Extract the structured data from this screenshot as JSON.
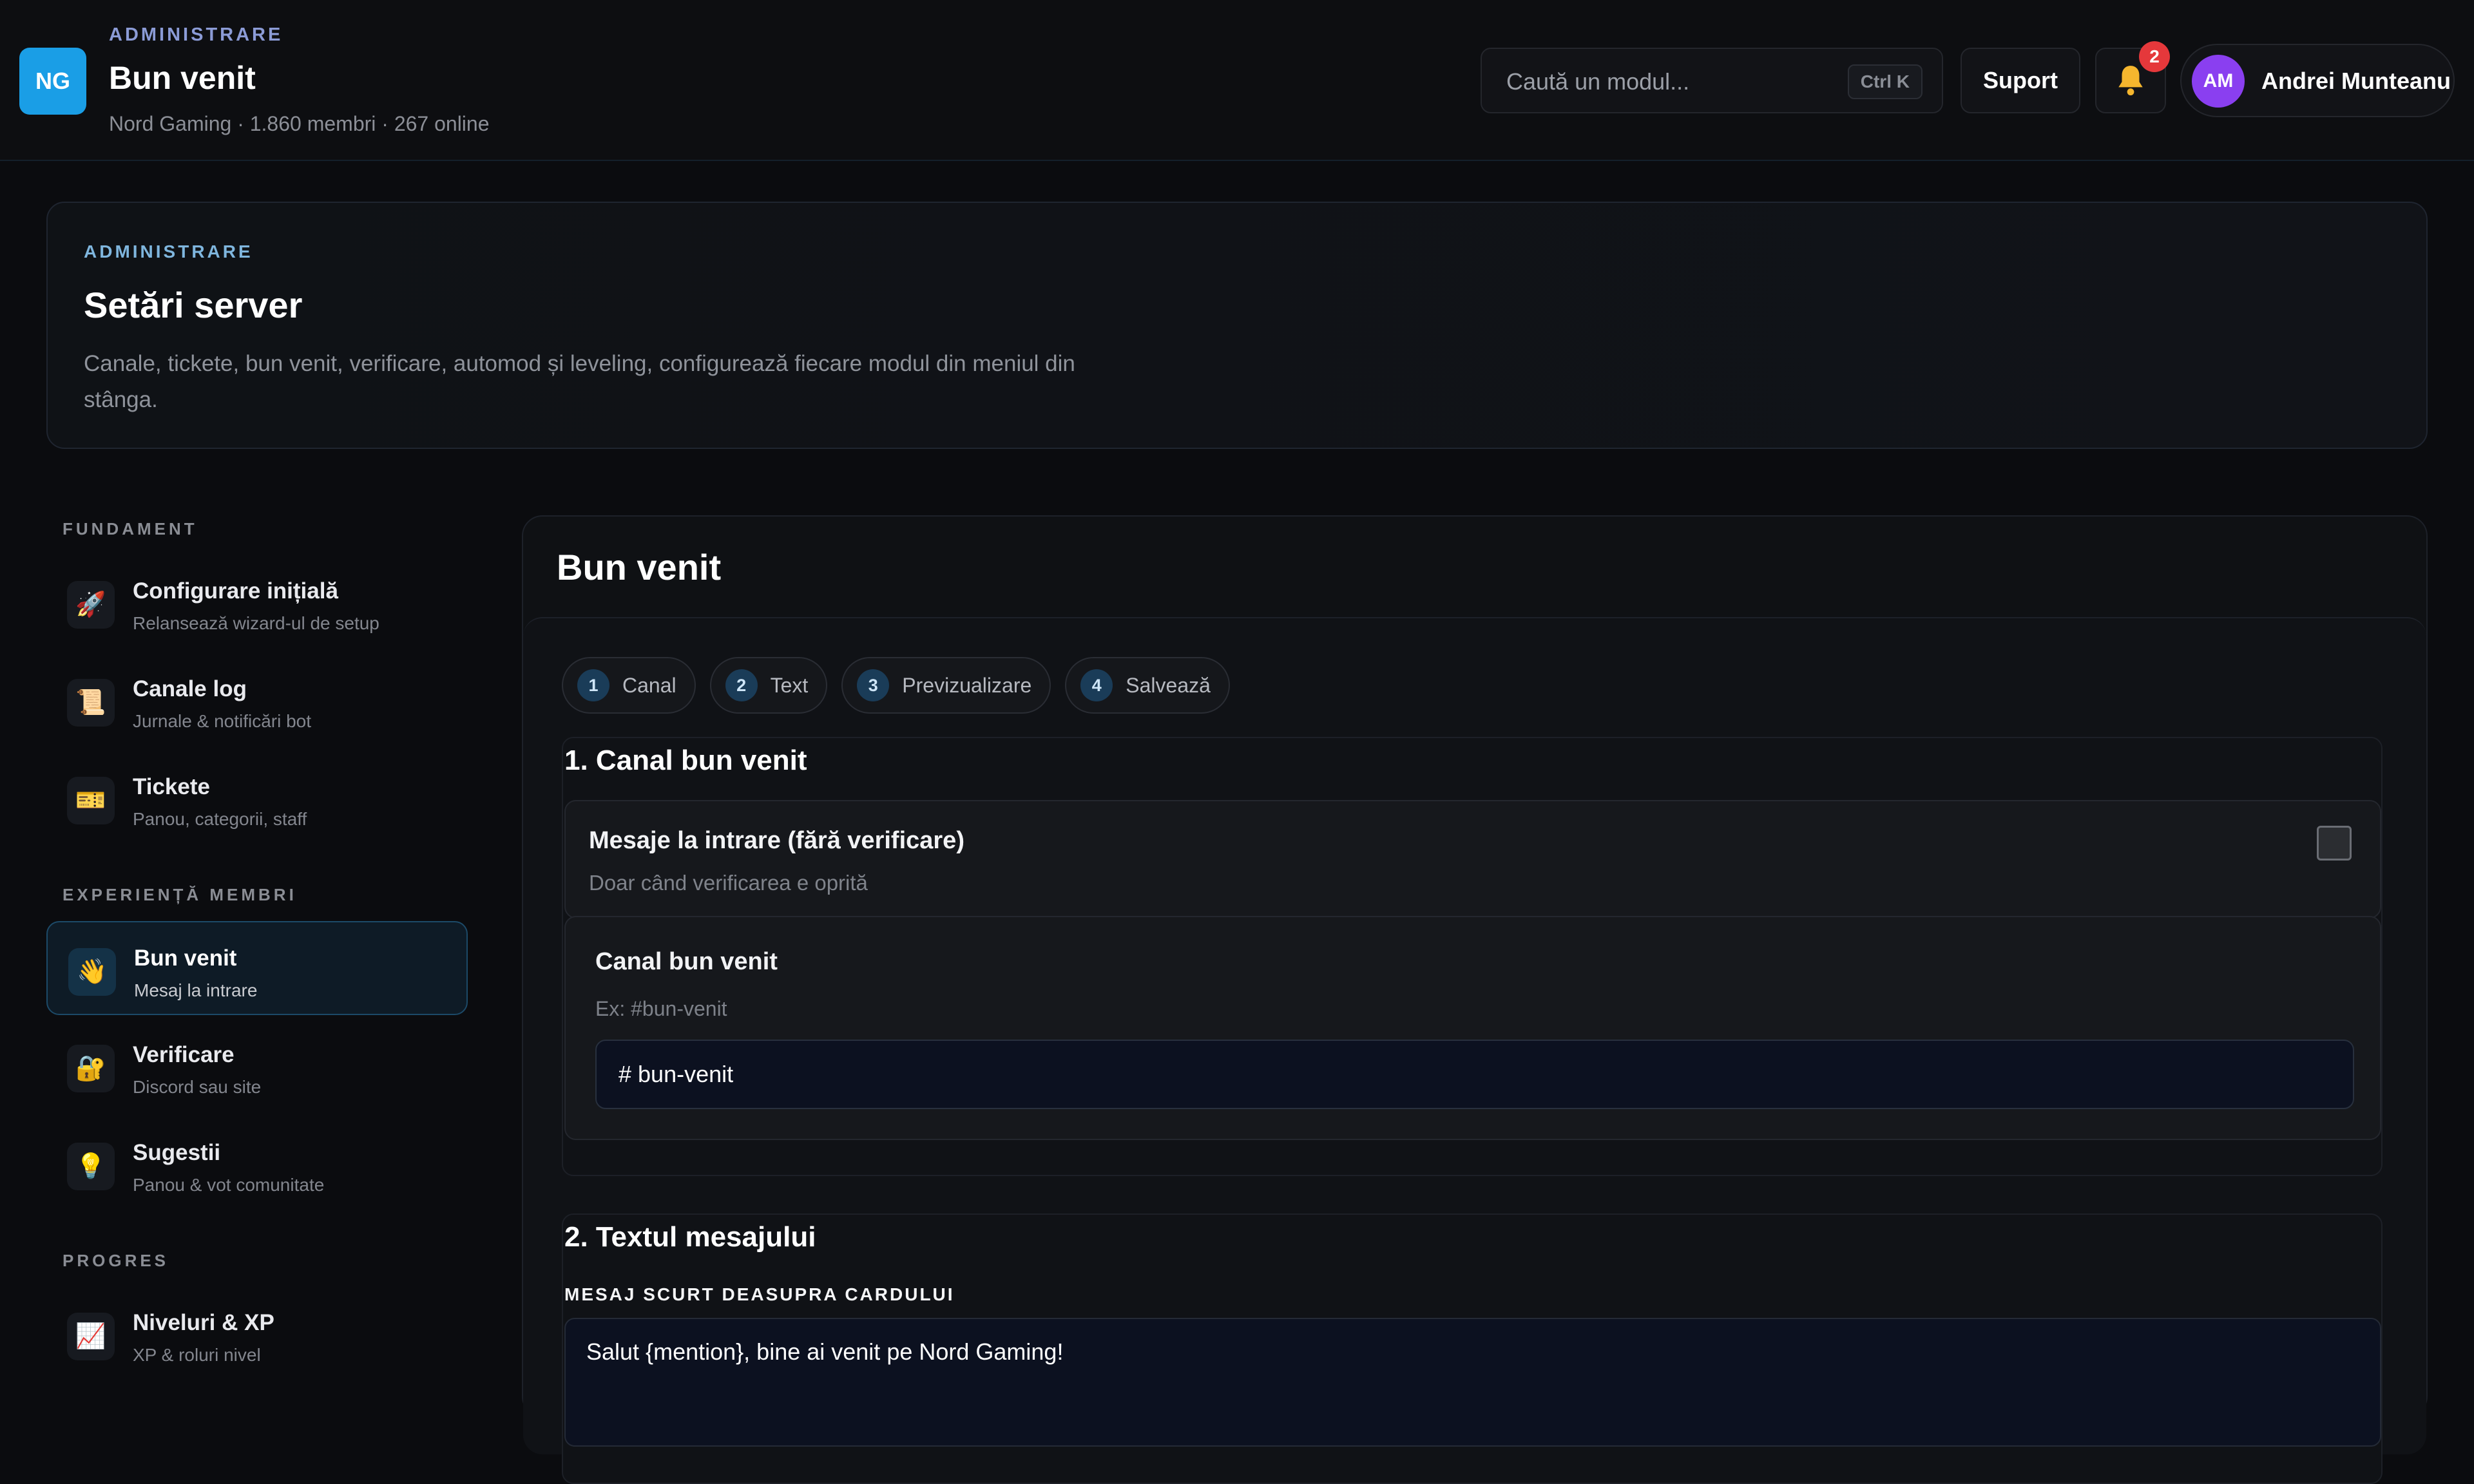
{
  "header": {
    "logo_initials": "NG",
    "eyebrow": "ADMINISTRARE",
    "title": "Bun venit",
    "subtitle": "Nord Gaming · 1.860 membri · 267 online",
    "search_placeholder": "Caută un modul...",
    "search_shortcut": "Ctrl K",
    "support_label": "Suport",
    "notification_count": "2",
    "user_initials": "AM",
    "user_name": "Andrei Munteanu"
  },
  "hero": {
    "eyebrow": "ADMINISTRARE",
    "title": "Setări server",
    "description": "Canale, tickete, bun venit, verificare, automod și leveling, configurează fiecare modul din meniul din stânga."
  },
  "sidebar": {
    "sections": [
      {
        "title": "FUNDAMENT",
        "items": [
          {
            "icon": "rocket-icon",
            "glyph": "🚀",
            "label": "Configurare inițială",
            "sub": "Relansează wizard-ul de setup"
          },
          {
            "icon": "scroll-icon",
            "glyph": "📜",
            "label": "Canale log",
            "sub": "Jurnale & notificări bot"
          },
          {
            "icon": "ticket-icon",
            "glyph": "🎫",
            "label": "Tickete",
            "sub": "Panou, categorii, staff"
          }
        ]
      },
      {
        "title": "EXPERIENȚĂ MEMBRI",
        "items": [
          {
            "icon": "wave-icon",
            "glyph": "👋",
            "label": "Bun venit",
            "sub": "Mesaj la intrare",
            "active": true
          },
          {
            "icon": "lock-icon",
            "glyph": "🔐",
            "label": "Verificare",
            "sub": "Discord sau site"
          },
          {
            "icon": "lightbulb-icon",
            "glyph": "💡",
            "label": "Sugestii",
            "sub": "Panou & vot comunitate"
          }
        ]
      },
      {
        "title": "PROGRES",
        "items": [
          {
            "icon": "chart-icon",
            "glyph": "📈",
            "label": "Niveluri & XP",
            "sub": "XP & roluri nivel"
          }
        ]
      }
    ]
  },
  "main": {
    "title": "Bun venit",
    "steps": [
      {
        "num": "1",
        "label": "Canal"
      },
      {
        "num": "2",
        "label": "Text"
      },
      {
        "num": "3",
        "label": "Previzualizare"
      },
      {
        "num": "4",
        "label": "Salvează"
      }
    ],
    "section1": {
      "title": "1. Canal bun venit",
      "toggle_title": "Mesaje la intrare (fără verificare)",
      "toggle_sub": "Doar când verificarea e oprită",
      "toggle_checked": false,
      "field_label": "Canal bun venit",
      "field_hint": "Ex: #bun-venit",
      "field_value": "# bun-venit"
    },
    "section2": {
      "title": "2. Textul mesajului",
      "short_label": "MESAJ SCURT DEASUPRA CARDULUI",
      "short_value": "Salut {mention}, bine ai venit pe Nord Gaming!"
    }
  }
}
